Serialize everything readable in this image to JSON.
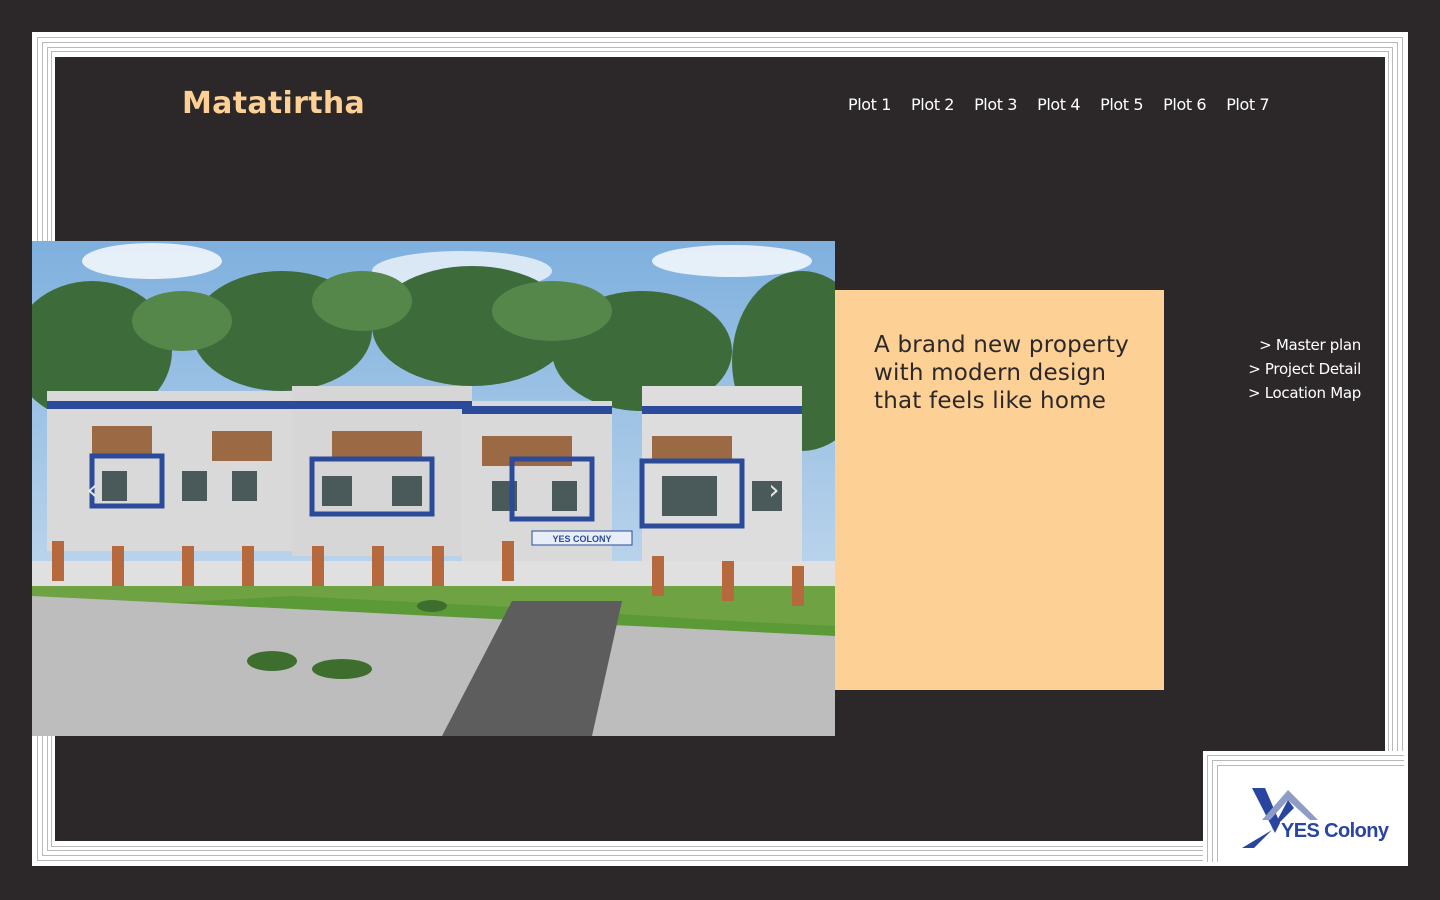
{
  "brand": {
    "title": "Matatirtha"
  },
  "nav": {
    "items": [
      {
        "label": "Plot 1"
      },
      {
        "label": "Plot 2"
      },
      {
        "label": "Plot 3"
      },
      {
        "label": "Plot 4"
      },
      {
        "label": "Plot 5"
      },
      {
        "label": "Plot 6"
      },
      {
        "label": "Plot 7"
      }
    ]
  },
  "hero": {
    "prev_icon": "chevron-left-icon",
    "next_icon": "chevron-right-icon",
    "gate_sign": "YES COLONY"
  },
  "card": {
    "tagline": "A brand new property with modern design that feels like home"
  },
  "side_links": [
    {
      "label": "> Master plan"
    },
    {
      "label": "> Project Detail"
    },
    {
      "label": "> Location Map"
    }
  ],
  "logo": {
    "text": "YES Colony"
  },
  "colors": {
    "background": "#2c2829",
    "accent_peach": "#fdd095",
    "frame": "#ffffff",
    "logo_blue": "#2a45a0"
  }
}
